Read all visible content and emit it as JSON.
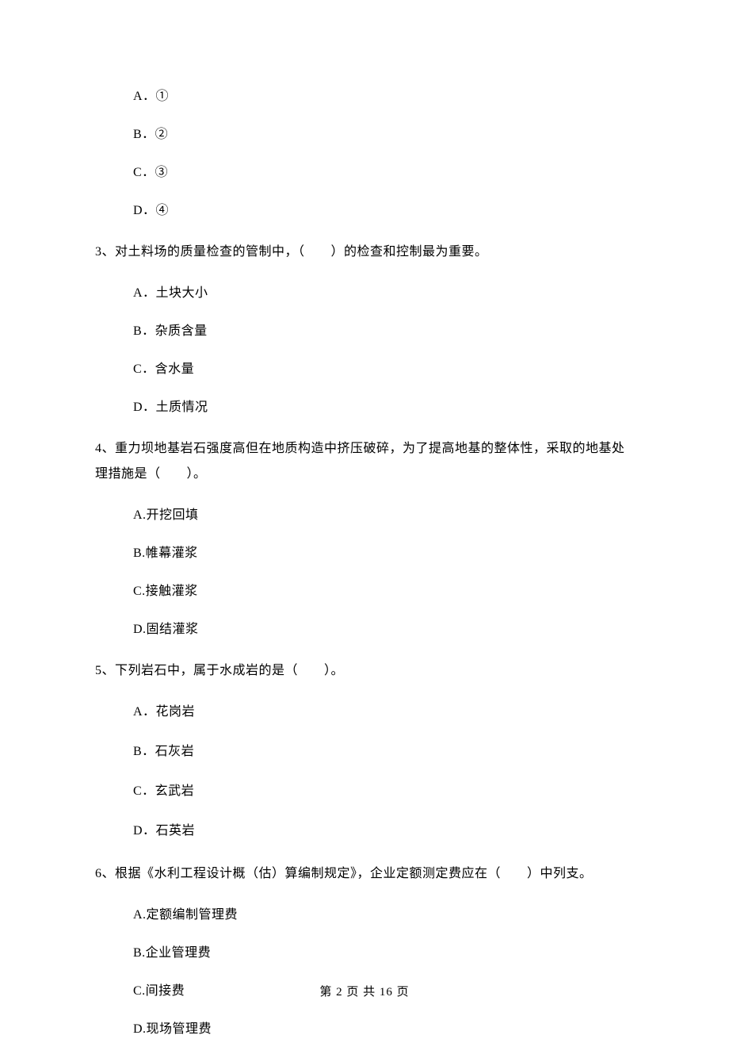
{
  "q2": {
    "a": "A．①",
    "b": "B．②",
    "c": "C．③",
    "d": "D．④"
  },
  "q3": {
    "stem": "3、对土料场的质量检查的管制中，（　　）的检查和控制最为重要。",
    "a": "A．土块大小",
    "b": "B．杂质含量",
    "c": "C．含水量",
    "d": "D．土质情况"
  },
  "q4": {
    "stem": "4、重力坝地基岩石强度高但在地质构造中挤压破碎，为了提高地基的整体性，采取的地基处理措施是（　　）。",
    "a": "A.开挖回填",
    "b": "B.帷幕灌浆",
    "c": "C.接触灌浆",
    "d": "D.固结灌浆"
  },
  "q5": {
    "stem": "5、下列岩石中，属于水成岩的是（　　）。",
    "a": "A．花岗岩",
    "b": "B．石灰岩",
    "c": "C．玄武岩",
    "d": "D．石英岩"
  },
  "q6": {
    "stem": "6、根据《水利工程设计概（估）算编制规定》，企业定额测定费应在（　　）中列支。",
    "a": "A.定额编制管理费",
    "b": "B.企业管理费",
    "c": "C.间接费",
    "d": "D.现场管理费"
  },
  "footer": "第 2 页 共 16 页"
}
